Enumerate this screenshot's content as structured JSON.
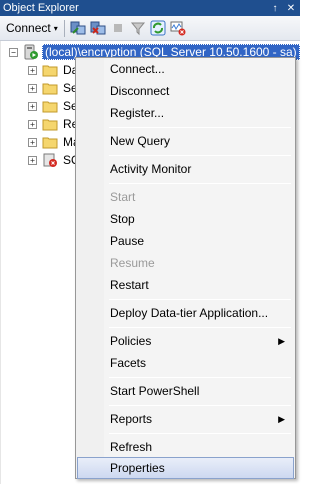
{
  "window": {
    "title": "Object Explorer",
    "pin_glyph": "↑",
    "close_glyph": "✕"
  },
  "toolbar": {
    "connect_label": "Connect",
    "connect_caret": "▾",
    "icons": [
      "connect-object-explorer-icon",
      "disconnect-icon",
      "stop-icon",
      "filter-icon",
      "refresh-icon",
      "activity-monitor-icon"
    ]
  },
  "tree": {
    "root_label": "(local)\\encryption (SQL Server 10.50.1600 - sa)",
    "children": [
      {
        "label": "Da",
        "icon": "folder-icon"
      },
      {
        "label": "Se",
        "icon": "folder-icon"
      },
      {
        "label": "Se",
        "icon": "folder-icon"
      },
      {
        "label": "Re",
        "icon": "folder-icon"
      },
      {
        "label": "Ma",
        "icon": "folder-icon"
      },
      {
        "label": "SQ",
        "icon": "sql-agent-icon"
      }
    ],
    "expander_collapsed": "+",
    "expander_expanded": "−"
  },
  "context_menu": {
    "items": [
      {
        "label": "Connect...",
        "enabled": true
      },
      {
        "label": "Disconnect",
        "enabled": true
      },
      {
        "label": "Register...",
        "enabled": true
      },
      {
        "label": "New Query",
        "enabled": true
      },
      {
        "label": "Activity Monitor",
        "enabled": true
      },
      {
        "label": "Start",
        "enabled": false
      },
      {
        "label": "Stop",
        "enabled": true
      },
      {
        "label": "Pause",
        "enabled": true
      },
      {
        "label": "Resume",
        "enabled": false
      },
      {
        "label": "Restart",
        "enabled": true
      },
      {
        "label": "Deploy Data-tier Application...",
        "enabled": true
      },
      {
        "label": "Policies",
        "enabled": true,
        "submenu": true
      },
      {
        "label": "Facets",
        "enabled": true
      },
      {
        "label": "Start PowerShell",
        "enabled": true
      },
      {
        "label": "Reports",
        "enabled": true,
        "submenu": true
      },
      {
        "label": "Refresh",
        "enabled": true
      },
      {
        "label": "Properties",
        "enabled": true,
        "highlighted": true
      }
    ],
    "submenu_arrow": "▶"
  },
  "colors": {
    "titlebar": "#1f4f8f",
    "selection": "#3165c5",
    "menu_highlight": "#cdd8f0"
  }
}
